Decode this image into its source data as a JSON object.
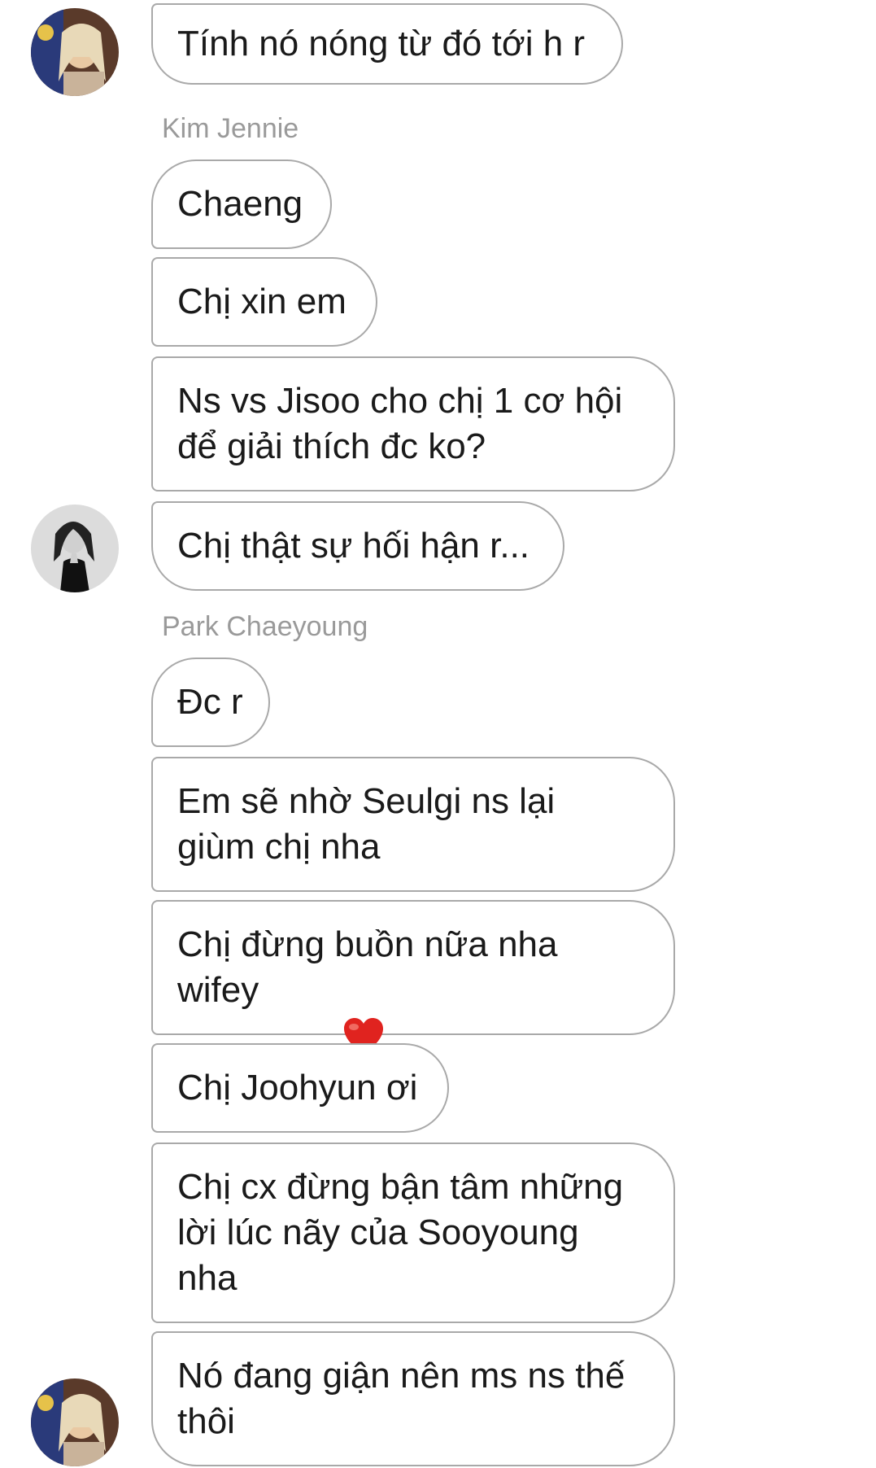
{
  "messages": [
    {
      "id": "m1",
      "text": "Tính nó nóng từ đó tới h r"
    },
    {
      "id": "m2",
      "text": "Chaeng"
    },
    {
      "id": "m3",
      "text": "Chị xin em"
    },
    {
      "id": "m4",
      "text": "Ns vs Jisoo cho chị 1 cơ hội\nđể giải thích đc ko?"
    },
    {
      "id": "m5",
      "text": "Chị thật sự hối hận r..."
    },
    {
      "id": "m6",
      "text": "Đc r"
    },
    {
      "id": "m7",
      "text": "Em sẽ nhờ Seulgi ns lại\ngiùm chị nha"
    },
    {
      "id": "m8a",
      "text": "Chị đừng buồn nữa nha\nwifey"
    },
    {
      "id": "m9",
      "text": "Chị Joohyun ơi"
    },
    {
      "id": "m10",
      "text": "Chị cx đừng bận tâm những\nlời lúc nãy của Sooyoung\nnha"
    },
    {
      "id": "m11",
      "text": "Nó đang giận nên ms ns thế\nthôi"
    }
  ],
  "senders": {
    "kim_jennie": "Kim Jennie",
    "park_chaeyoung": "Park Chaeyoung"
  },
  "emoji": {
    "m8_heart": "heart-emoji",
    "heart_color": "#e0231f"
  },
  "colors": {
    "bubble_border": "#a9a9a9",
    "sender_name": "#9a9a9a",
    "text": "#1a1a1a"
  }
}
